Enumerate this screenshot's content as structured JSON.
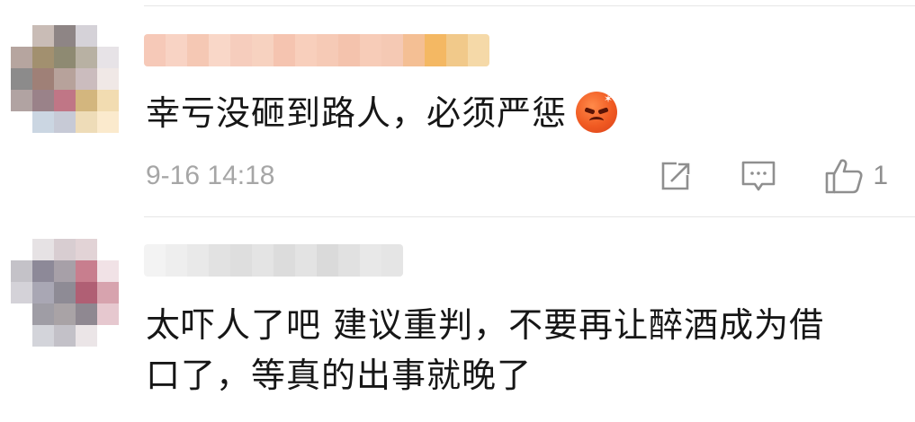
{
  "comments": [
    {
      "text": "幸亏没砸到路人，必须严惩",
      "emoji": "angry-face-emoji",
      "timestamp": "9-16 14:18",
      "like_count": "1",
      "avatar_colors": [
        "#ffffff",
        "#c9bcb6",
        "#8e8585",
        "#d5d2d8",
        "#ffffff",
        "#b6a59f",
        "#a2906f",
        "#8e8a72",
        "#b8b1a3",
        "#e7e3e7",
        "#8c8b8b",
        "#9f8077",
        "#b7a29b",
        "#cbbcbe",
        "#f0e8e6",
        "#b1a3a2",
        "#9a8289",
        "#c07686",
        "#d3b67e",
        "#f2dcb1",
        "#ffffff",
        "#cbd6e2",
        "#c7cad6",
        "#eedcb8",
        "#fbeacd"
      ],
      "username_colors": [
        "#f6c9b8",
        "#f8d3c4",
        "#f5c8b4",
        "#f9d7c8",
        "#f6cdbd",
        "#f7d2c0",
        "#f5c4b0",
        "#f8cfbc",
        "#f6cab6",
        "#f4c3ad",
        "#f7ccb8",
        "#f5c9b4",
        "#f4bf94",
        "#f4b863",
        "#f1c98a",
        "#f5d9a8"
      ]
    },
    {
      "text_line1": "太吓人了吧 建议重判，不要再让醉酒成为借",
      "text_line2": "口了，等真的出事就晚了",
      "avatar_colors": [
        "#ffffff",
        "#e6e2e4",
        "#d8cdd1",
        "#e2d3d6",
        "#ffffff",
        "#c4c2c8",
        "#8d8998",
        "#a7a0a8",
        "#c87e8e",
        "#f1e2e6",
        "#d4d2d8",
        "#a9a7b4",
        "#8e8b95",
        "#b05f74",
        "#d7a3ae",
        "#ffffff",
        "#9f9da5",
        "#a9a3a6",
        "#8f8891",
        "#e6c8cf",
        "#ffffff",
        "#d3d4da",
        "#c3c1c8",
        "#ebe5e7",
        "#ffffff"
      ],
      "username_colors": [
        "#f3f3f3",
        "#eeeeee",
        "#e9e9e9",
        "#e2e2e2",
        "#dedede",
        "#e4e4e4",
        "#dcdcdc",
        "#e3e3e3",
        "#dadada",
        "#e1e1e1",
        "#e8e8e8",
        "#e5e5e5"
      ]
    }
  ],
  "icons": {
    "share": "share-icon",
    "comment": "comment-icon",
    "like": "like-icon"
  },
  "colors": {
    "text": "#161616",
    "meta": "#a6a6a6",
    "icon": "#8f8f8f",
    "divider": "#e6e6e6"
  }
}
